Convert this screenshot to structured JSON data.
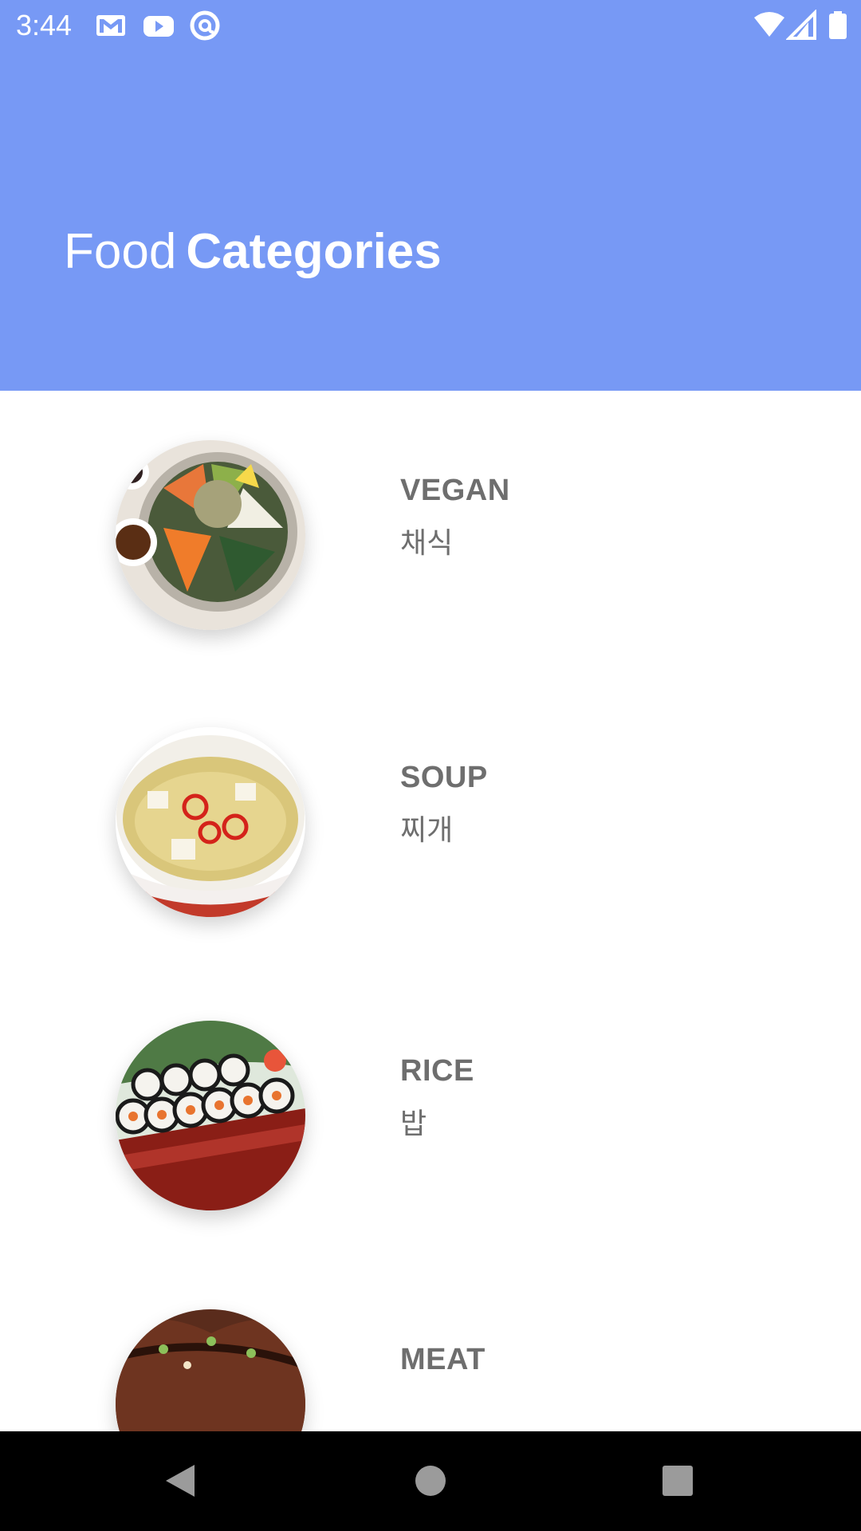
{
  "status_bar": {
    "time": "3:44",
    "left_icons": [
      "gmail-icon",
      "youtube-icon",
      "at-sign-icon"
    ],
    "right_icons": [
      "wifi-icon",
      "cell-signal-icon",
      "battery-icon"
    ]
  },
  "header": {
    "title_light": "Food",
    "title_bold": "Categories",
    "background_color": "#7799f5"
  },
  "categories": [
    {
      "name": "VEGAN",
      "korean": "채식",
      "image": "bibimbap-image"
    },
    {
      "name": "SOUP",
      "korean": "찌개",
      "image": "soup-bowl-image"
    },
    {
      "name": "RICE",
      "korean": "밥",
      "image": "kimbap-image"
    },
    {
      "name": "MEAT",
      "korean": "",
      "image": "grilled-meat-image"
    }
  ],
  "nav_bar": {
    "buttons": [
      "back-icon",
      "home-icon",
      "recents-icon"
    ]
  }
}
